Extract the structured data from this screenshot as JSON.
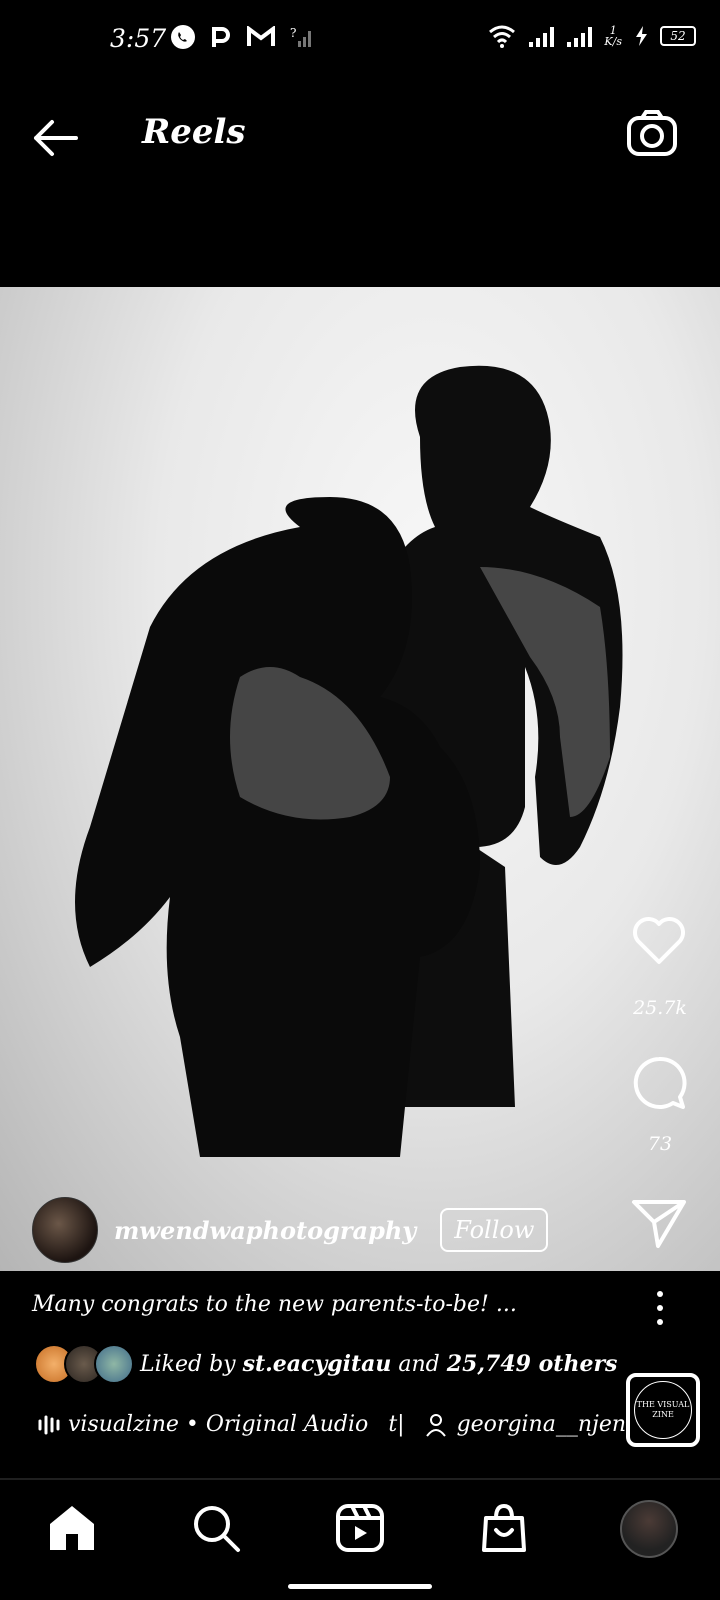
{
  "status_bar": {
    "time": "3:57",
    "net_speed_top": "1",
    "net_speed_unit": "K/s",
    "battery": "52"
  },
  "header": {
    "title": "Reels",
    "back_icon": "arrow-left-icon",
    "camera_icon": "camera-icon"
  },
  "reel": {
    "likes_count": "25.7k",
    "comments_count": "73",
    "author": "mwendwaphotography",
    "follow_label": "Follow",
    "caption": "Many congrats to the new parents-to-be! ...",
    "liked_by_prefix": "Liked by",
    "liked_by_user": "st.eacygitau",
    "liked_by_middle": "and",
    "liked_by_others": "25,749 others",
    "audio": "visualzine • Original Audio",
    "audio_sep": "t|",
    "tagged_user": "georgina__njenga",
    "thumb_text": "THE VISUAL ZINE"
  },
  "colors": {
    "background": "#000000",
    "text": "#ffffff"
  },
  "nav": {
    "items": [
      "home-icon",
      "search-icon",
      "reels-icon",
      "shop-icon",
      "profile-avatar"
    ]
  }
}
